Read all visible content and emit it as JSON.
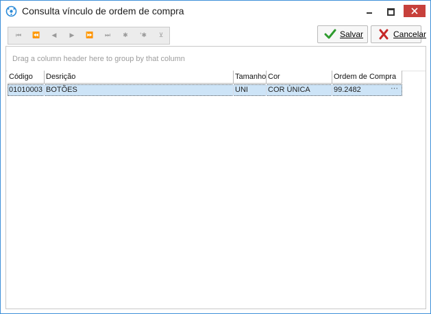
{
  "window": {
    "title": "Consulta vínculo de ordem de compra"
  },
  "navigator": {
    "buttons": [
      "⏮",
      "⏪",
      "◀",
      "▶",
      "⏩",
      "⏭",
      "✱",
      "'✱",
      "⊻"
    ]
  },
  "actions": {
    "save_label": "Salvar",
    "cancel_label": "Cancelar"
  },
  "grid": {
    "group_panel_text": "Drag a column header here to group by that column",
    "columns": [
      "Código",
      "Desrição",
      "Tamanho",
      "Cor",
      "Ordem de Compra"
    ],
    "rows": [
      {
        "codigo": "01010003",
        "descricao": "BOTÕES",
        "tamanho": "UNI",
        "cor": "COR ÚNICA",
        "ordem": "99.2482"
      }
    ],
    "ellipsis": "···"
  },
  "colors": {
    "accent": "#3c8fd8",
    "selected_row": "#cde4f7",
    "save_check": "#2e9b2e",
    "cancel_x": "#c62828"
  }
}
